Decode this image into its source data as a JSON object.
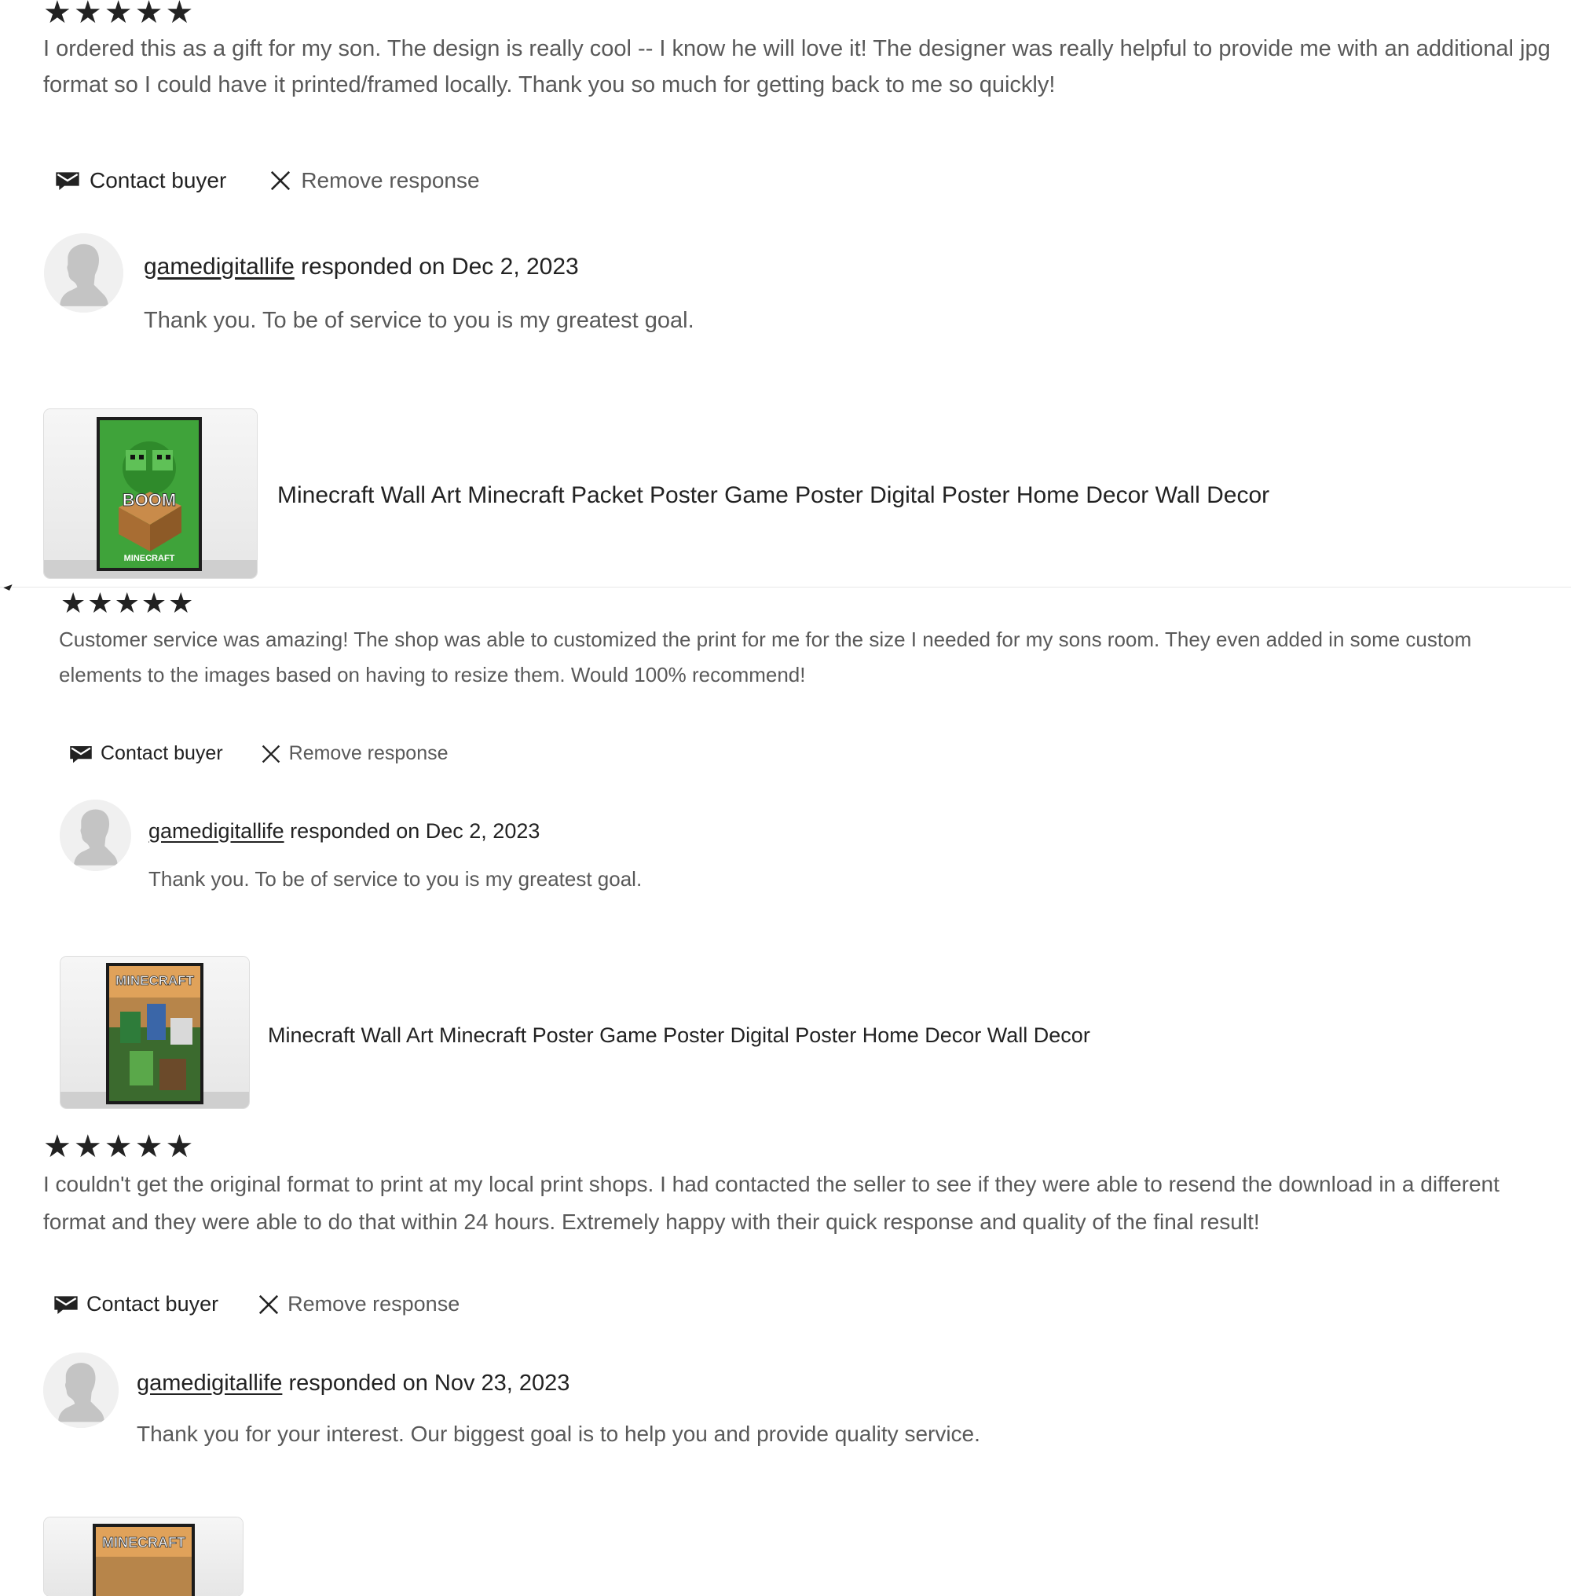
{
  "reviews": [
    {
      "stars": 5,
      "text": "I ordered this as a gift for my son. The design is really cool -- I know he will love it! The designer was really helpful to provide me with an additional jpg format so I could have it printed/framed locally. Thank you so much for getting back to me so quickly!",
      "contact_label": "Contact buyer",
      "remove_label": "Remove response",
      "seller": "gamedigitallife",
      "responded": "responded on Dec 2, 2023",
      "response": "Thank you. To be of service to you is my greatest goal.",
      "listing_title": "Minecraft Wall Art Minecraft Packet Poster Game Poster Digital Poster Home Decor Wall Decor",
      "poster_label": "MINECRAFT",
      "poster_badge": "BOOM"
    },
    {
      "stars": 5,
      "text": "Customer service was amazing! The shop was able to customized the print for me for the size I needed for my sons room. They even added in some custom elements to the images based on having to resize them. Would 100% recommend!",
      "contact_label": "Contact buyer",
      "remove_label": "Remove response",
      "seller": "gamedigitallife",
      "responded": "responded on Dec 2, 2023",
      "response": "Thank you. To be of service to you is my greatest goal.",
      "listing_title": "Minecraft Wall Art Minecraft Poster Game Poster Digital Poster Home Decor Wall Decor",
      "poster_label": "MINECRAFT"
    },
    {
      "stars": 5,
      "text": "I couldn't get the original format to print at my local print shops. I had contacted the seller to see if they were able to resend the download in a different format and they were able to do that within 24 hours. Extremely happy with their quick response and quality of the final result!",
      "contact_label": "Contact buyer",
      "remove_label": "Remove response",
      "seller": "gamedigitallife",
      "responded": "responded on Nov 23, 2023",
      "response": "Thank you for your interest. Our biggest goal is to help you and provide quality service.",
      "poster_label": "MINECRAFT"
    }
  ],
  "colors": {
    "text_primary": "#222222",
    "text_secondary": "#595959",
    "avatar_bg": "#eeeeee",
    "poster_green": "#3fa33a",
    "poster_dark": "#2a2a2a"
  },
  "icons": {
    "star": "star-icon",
    "contact": "envelope-icon",
    "remove": "close-icon",
    "avatar": "default-avatar-icon"
  }
}
